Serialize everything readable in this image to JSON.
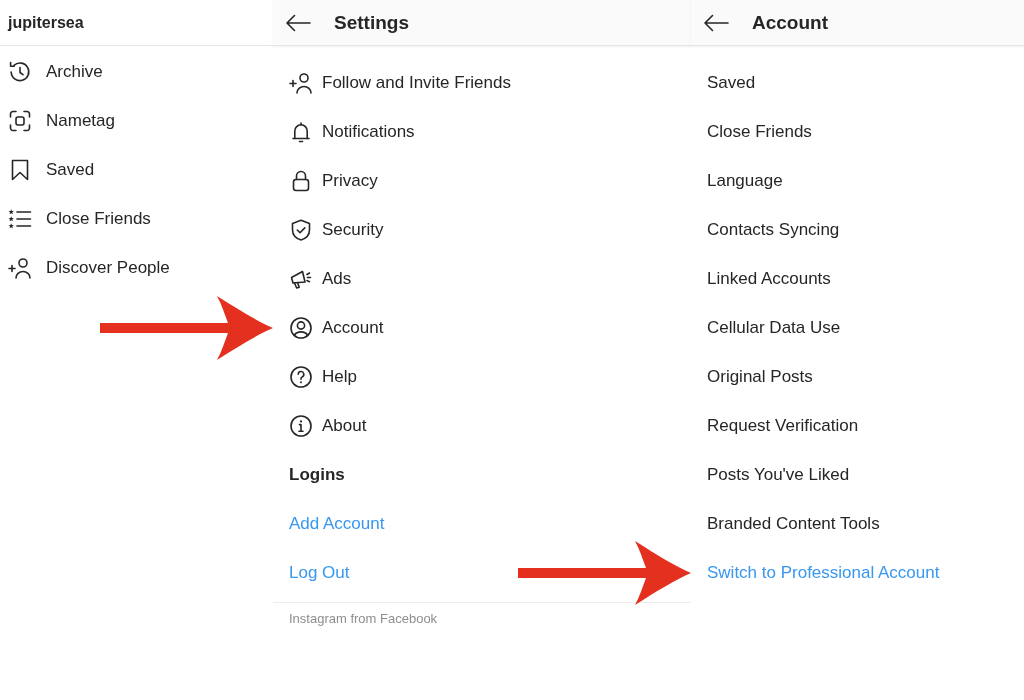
{
  "profile_menu": {
    "username": "jupitersea",
    "items": [
      {
        "label": "Archive"
      },
      {
        "label": "Nametag"
      },
      {
        "label": "Saved"
      },
      {
        "label": "Close Friends"
      },
      {
        "label": "Discover People"
      }
    ]
  },
  "settings": {
    "title": "Settings",
    "back_button": true,
    "items": [
      {
        "kind": "item",
        "label": "Follow and Invite Friends",
        "arrow": false
      },
      {
        "kind": "item",
        "label": "Notifications",
        "arrow": false
      },
      {
        "kind": "item",
        "label": "Privacy",
        "arrow": false
      },
      {
        "kind": "item",
        "label": "Security",
        "arrow": false
      },
      {
        "kind": "item",
        "label": "Ads",
        "arrow": false
      },
      {
        "kind": "item",
        "label": "Account",
        "arrow": true
      },
      {
        "kind": "item",
        "label": "Help",
        "arrow": false
      },
      {
        "kind": "item",
        "label": "About",
        "arrow": false
      },
      {
        "kind": "section",
        "label": "Logins",
        "arrow": false
      },
      {
        "kind": "link",
        "label": "Add Account",
        "arrow": false
      },
      {
        "kind": "link",
        "label": "Log Out",
        "arrow": false
      }
    ],
    "footer": "Instagram from Facebook"
  },
  "account": {
    "title": "Account",
    "back_button": true,
    "items": [
      {
        "kind": "item",
        "label": "Saved",
        "arrow": false
      },
      {
        "kind": "item",
        "label": "Close Friends",
        "arrow": false
      },
      {
        "kind": "item",
        "label": "Language",
        "arrow": false
      },
      {
        "kind": "item",
        "label": "Contacts Syncing",
        "arrow": false
      },
      {
        "kind": "item",
        "label": "Linked Accounts",
        "arrow": false
      },
      {
        "kind": "item",
        "label": "Cellular Data Use",
        "arrow": false
      },
      {
        "kind": "item",
        "label": "Original Posts",
        "arrow": false
      },
      {
        "kind": "item",
        "label": "Request Verification",
        "arrow": false
      },
      {
        "kind": "item",
        "label": "Posts You've Liked",
        "arrow": false
      },
      {
        "kind": "item",
        "label": "Branded Content Tools",
        "arrow": false
      },
      {
        "kind": "link",
        "label": "Switch to Professional Account",
        "arrow": true
      }
    ]
  }
}
